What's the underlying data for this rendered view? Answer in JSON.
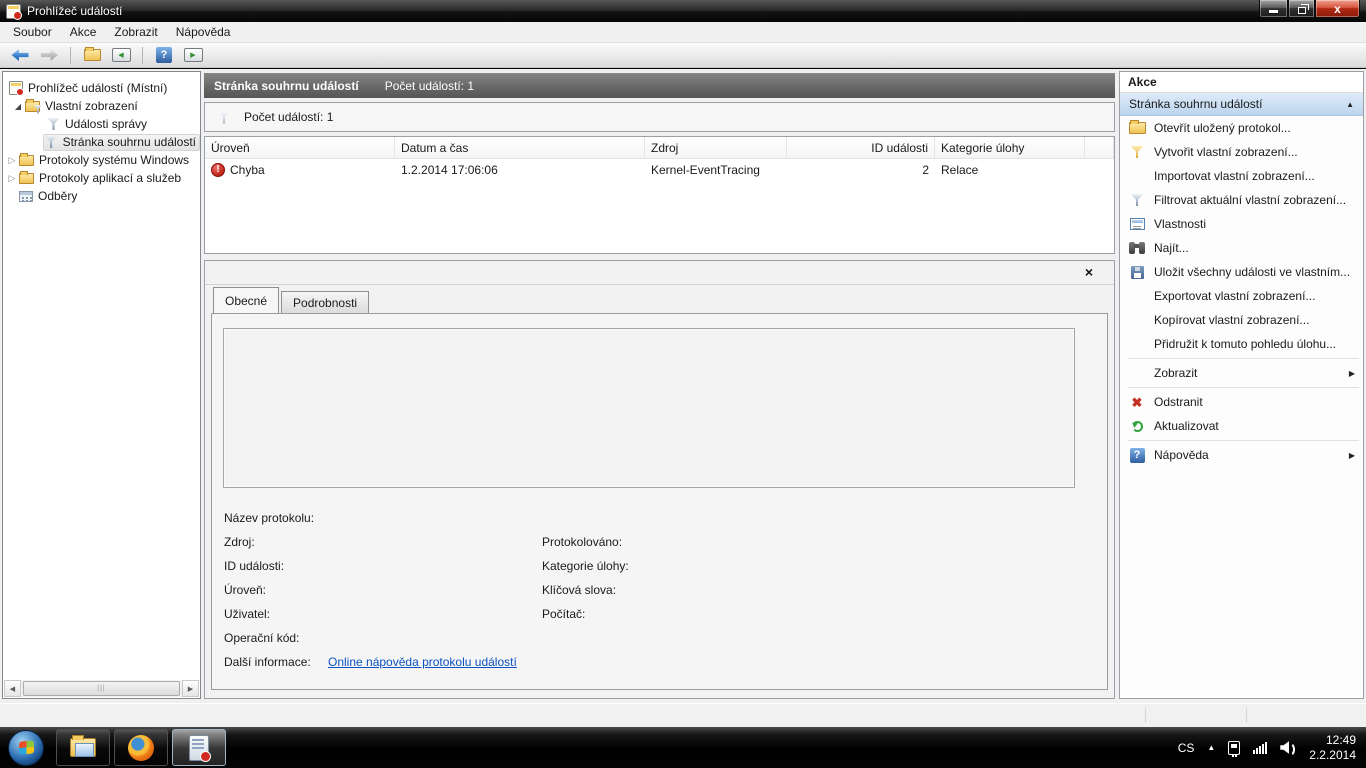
{
  "colors": {
    "link": "#0a52bf",
    "error_red": "#c62d22",
    "action_section_blue": "#bcd5ee",
    "header_gray": "#6a6a6a"
  },
  "window": {
    "title": "Prohlížeč událostí"
  },
  "menu": {
    "items": [
      {
        "label": "Soubor"
      },
      {
        "label": "Akce"
      },
      {
        "label": "Zobrazit"
      },
      {
        "label": "Nápověda"
      }
    ]
  },
  "toolbar": {
    "help_glyph": "?",
    "tree_toggle_glyph": "◀",
    "action_toggle_glyph": "▶"
  },
  "tree": {
    "items": [
      {
        "label": "Prohlížeč událostí (Místní)"
      },
      {
        "label": "Vlastní zobrazení"
      },
      {
        "label": "Události správy"
      },
      {
        "label": "Stránka souhrnu událostí"
      },
      {
        "label": "Protokoly systému Windows"
      },
      {
        "label": "Protokoly aplikací a služeb"
      },
      {
        "label": "Odběry"
      }
    ],
    "expanded_glyph": "◢",
    "collapsed_glyph": "▷"
  },
  "main": {
    "header": {
      "title": "Stránka souhrnu událostí",
      "count": "Počet událostí: 1"
    },
    "summary": {
      "count_label": "Počet událostí: 1"
    },
    "table": {
      "columns": [
        {
          "label": "Úroveň"
        },
        {
          "label": "Datum a čas"
        },
        {
          "label": "Zdroj"
        },
        {
          "label": "ID události"
        },
        {
          "label": "Kategorie úlohy"
        }
      ],
      "rows": [
        {
          "level": "Chyba",
          "level_icon": "error",
          "datetime": "1.2.2014 17:06:06",
          "source": "Kernel-EventTracing",
          "event_id": "2",
          "task_category": "Relace"
        }
      ]
    },
    "preview": {
      "close_glyph": "×",
      "tabs": [
        {
          "label": "Obecné"
        },
        {
          "label": "Podrobnosti"
        }
      ],
      "fields": {
        "log_name": "Název protokolu:",
        "source": "Zdroj:",
        "logged": "Protokolováno:",
        "event_id": "ID události:",
        "task_category": "Kategorie úlohy:",
        "level": "Úroveň:",
        "keywords": "Klíčová slova:",
        "user": "Uživatel:",
        "computer": "Počítač:",
        "opcode": "Operační kód:",
        "more_info": "Další informace:"
      },
      "link": "Online nápověda protokolu událostí"
    }
  },
  "actions": {
    "title": "Akce",
    "section": "Stránka souhrnu událostí",
    "items": [
      {
        "label": "Otevřít uložený protokol...",
        "icon": "open-folder"
      },
      {
        "label": "Vytvořit vlastní zobrazení...",
        "icon": "create-filter"
      },
      {
        "label": "Importovat vlastní zobrazení...",
        "icon": ""
      },
      {
        "label": "Filtrovat aktuální vlastní zobrazení...",
        "icon": "filter"
      },
      {
        "label": "Vlastnosti",
        "icon": "properties"
      },
      {
        "label": "Najít...",
        "icon": "find"
      },
      {
        "label": "Uložit všechny události ve vlastním...",
        "icon": "save"
      },
      {
        "label": "Exportovat vlastní zobrazení...",
        "icon": ""
      },
      {
        "label": "Kopírovat vlastní zobrazení...",
        "icon": ""
      },
      {
        "label": "Přidružit k tomuto pohledu úlohu...",
        "icon": ""
      },
      {
        "label": "Zobrazit",
        "icon": "",
        "submenu": true
      },
      {
        "label": "Odstranit",
        "icon": "delete"
      },
      {
        "label": "Aktualizovat",
        "icon": "refresh"
      },
      {
        "label": "Nápověda",
        "icon": "help",
        "submenu": true
      }
    ],
    "help_glyph": "?",
    "delete_glyph": "✖",
    "submenu_glyph": "▶",
    "collapse_glyph": "▲"
  },
  "taskbar": {
    "tray": {
      "language": "CS",
      "hidden_icons_glyph": "▲",
      "time": "12:49",
      "date": "2.2.2014"
    }
  }
}
